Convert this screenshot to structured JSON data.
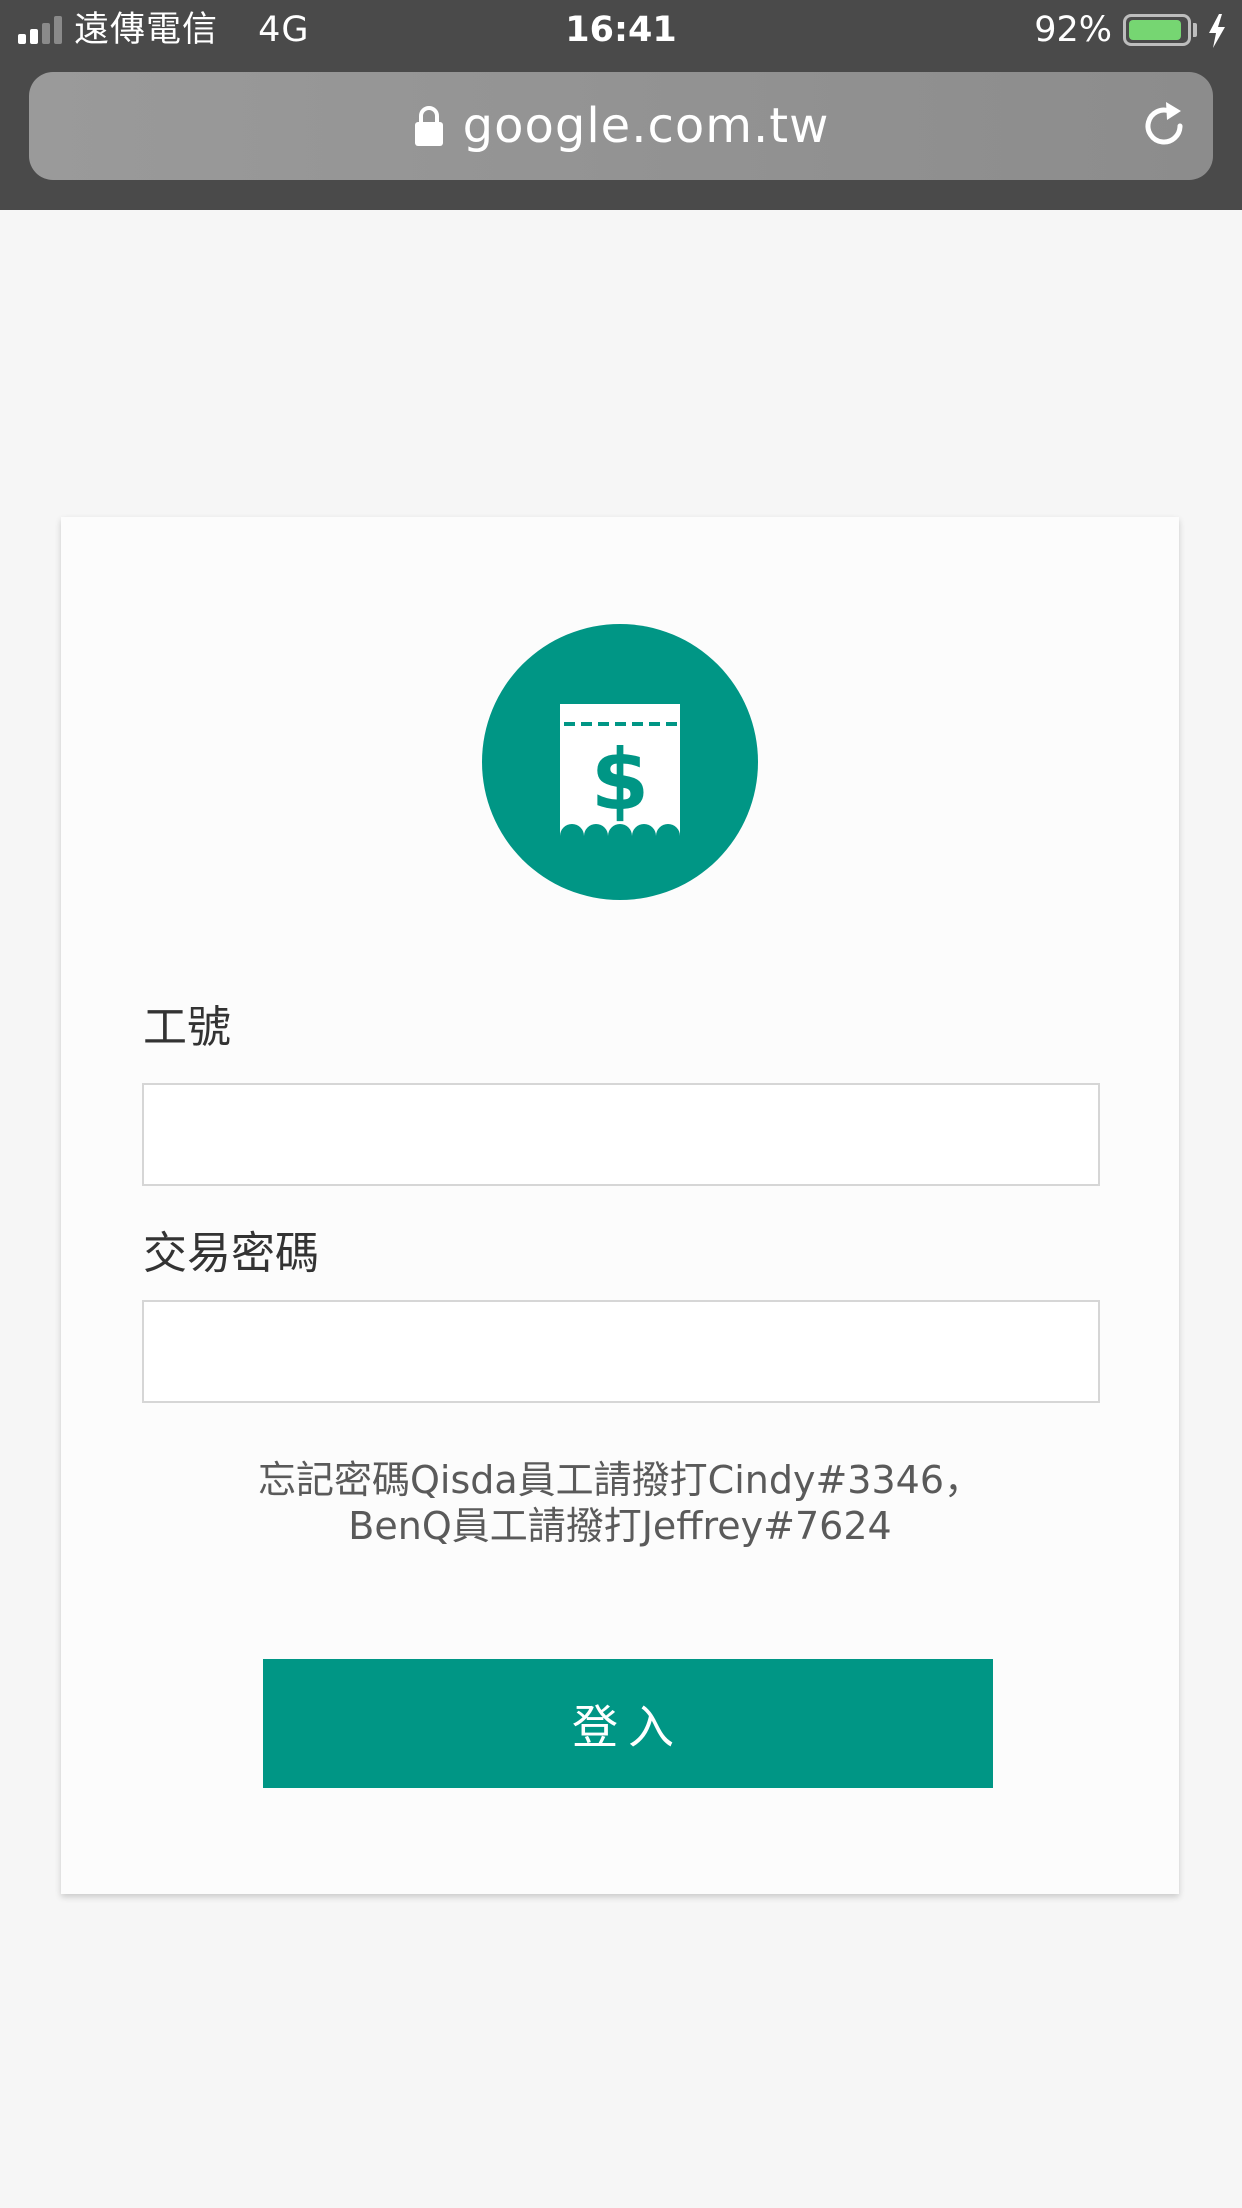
{
  "status_bar": {
    "carrier": "遠傳電信",
    "network": "4G",
    "time": "16:41",
    "battery_percent_label": "92%",
    "battery_level": 0.92,
    "signal_bars_active": 2,
    "signal_bars_total": 4,
    "charging": true,
    "battery_color": "#76d672"
  },
  "browser": {
    "url": "google.com.tw",
    "secure_icon": "lock-icon",
    "reload_icon": "reload-icon"
  },
  "login_form": {
    "logo_icon": "receipt-dollar-icon",
    "accent_color": "#009685",
    "employee_id": {
      "label": "工號",
      "value": ""
    },
    "password": {
      "label": "交易密碼",
      "value": ""
    },
    "help_line_1": "忘記密碼Qisda員工請撥打Cindy#3346，",
    "help_line_2": "BenQ員工請撥打Jeffrey#7624",
    "submit_label": "登入"
  }
}
